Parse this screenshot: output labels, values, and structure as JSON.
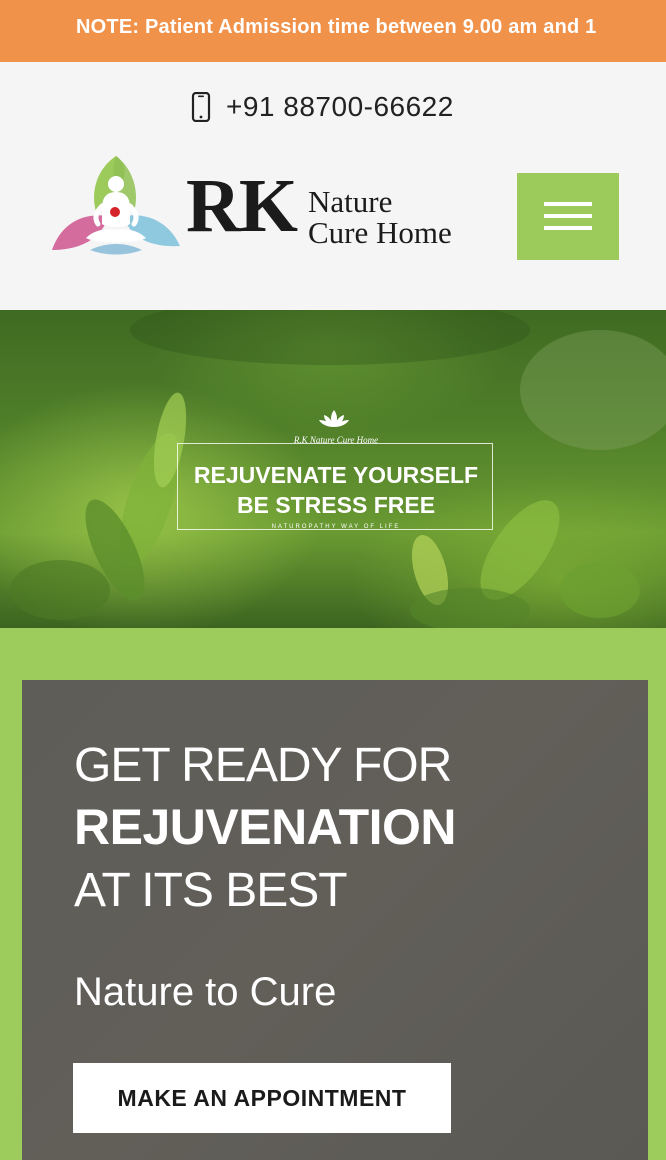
{
  "notice": {
    "text": "NOTE: Patient Admission time between 9.00 am and 1"
  },
  "header": {
    "phone_icon": "mobile-phone-icon",
    "phone": "+91 88700-66622",
    "logo": {
      "main": "RK",
      "line1": "Nature",
      "line2": "Cure Home"
    },
    "menu_icon": "hamburger-menu-icon"
  },
  "hero": {
    "brand": "R.K Nature Cure Home",
    "line1": "REJUVENATE YOURSELF",
    "line2": "BE STRESS FREE",
    "tagline": "NATUROPATHY WAY OF LIFE"
  },
  "promo": {
    "line1": "GET READY FOR",
    "line2": "REJUVENATION",
    "line3": "AT ITS BEST",
    "subtitle": "Nature to Cure",
    "button": "MAKE AN APPOINTMENT"
  },
  "colors": {
    "notice_bg": "#f0924a",
    "accent_green": "#9dcb5c",
    "card_gray": "#5f5e59"
  }
}
